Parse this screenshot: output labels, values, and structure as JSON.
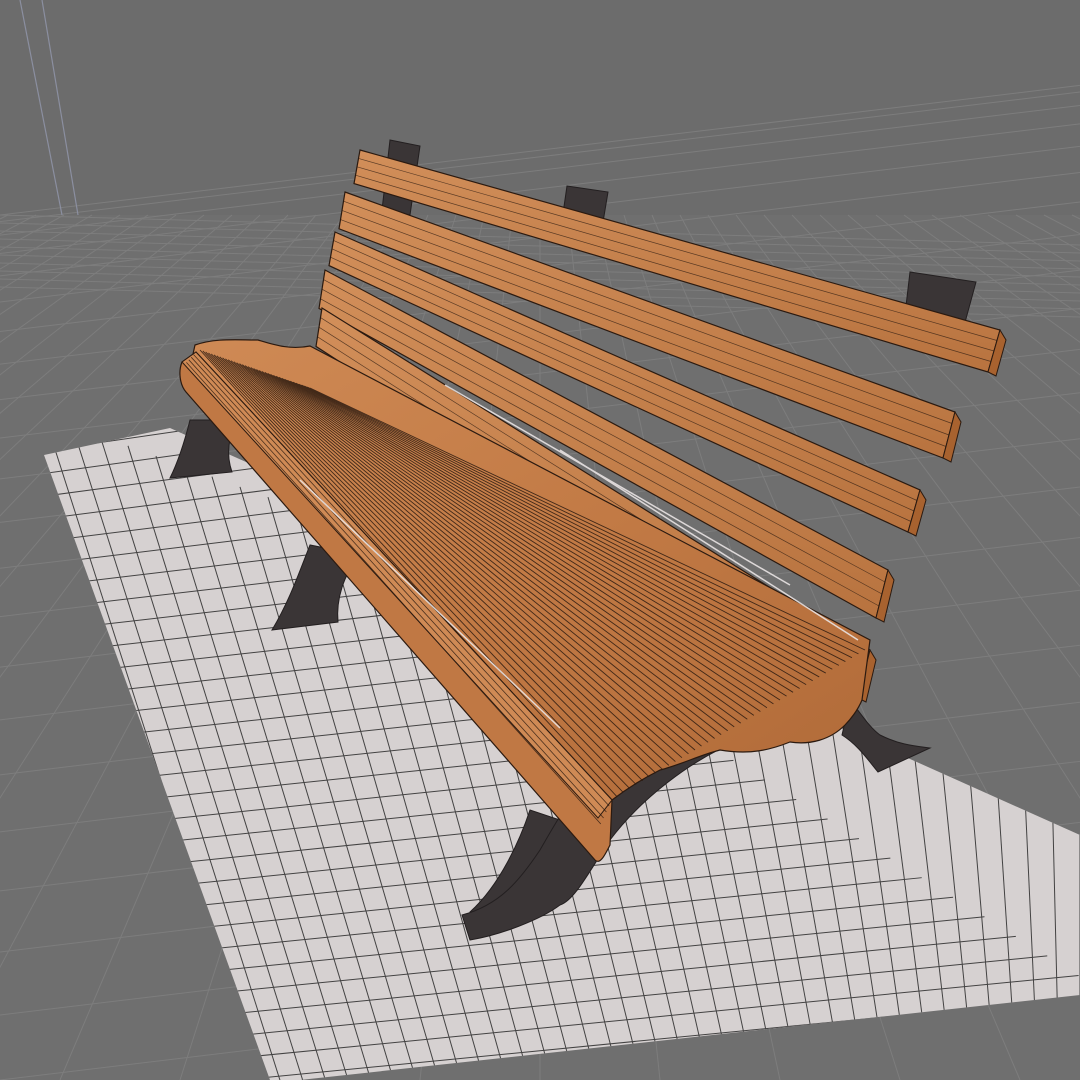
{
  "viewport": {
    "background_color": "#6f6f6f",
    "floor_grid_color": "#5f5f5f",
    "floor_grid_line_color": "#7c7c7c",
    "far_grid_line_color": "#828282",
    "construction_line_color": "#8a8a96",
    "ground_plane_color": "#d6d1d1",
    "ground_plane_line_color": "#1e1e1e",
    "wood_color": "#c27a45",
    "wood_light_color": "#d08a54",
    "wood_dark_color": "#8a4e27",
    "wireframe_color": "#2b1a10",
    "metal_color": "#3a3536",
    "metal_edge_color": "#2a2627"
  },
  "scene": {
    "model": "bench-model",
    "icons": [
      "park-bench-icon"
    ],
    "display_mode": "wireframe-on-shaded"
  }
}
